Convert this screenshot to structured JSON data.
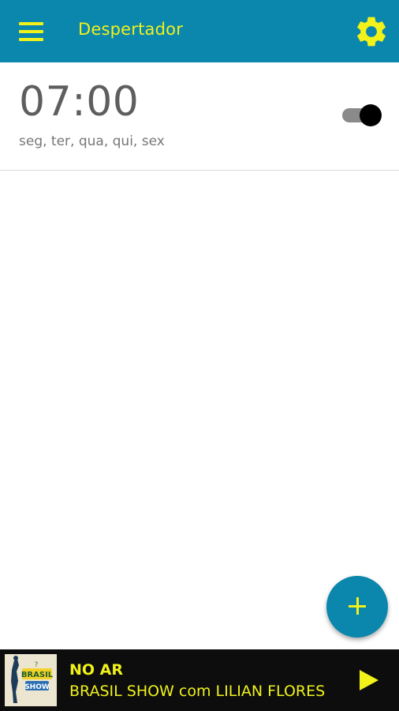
{
  "appbar": {
    "title": "Despertador",
    "menu_icon": "hamburger-menu-icon",
    "settings_icon": "gear-icon",
    "background_color": "#0b86ad",
    "accent_color": "#f0f21a"
  },
  "alarms": [
    {
      "time": "07:00",
      "days": "seg, ter, qua, qui, sex",
      "enabled": true
    }
  ],
  "fab": {
    "icon": "plus-icon"
  },
  "now_playing": {
    "status": "NO AR",
    "program": "BRASIL SHOW com LILIAN FLORES",
    "logo_text": "BRASIL SHOW",
    "play_icon": "play-icon"
  }
}
